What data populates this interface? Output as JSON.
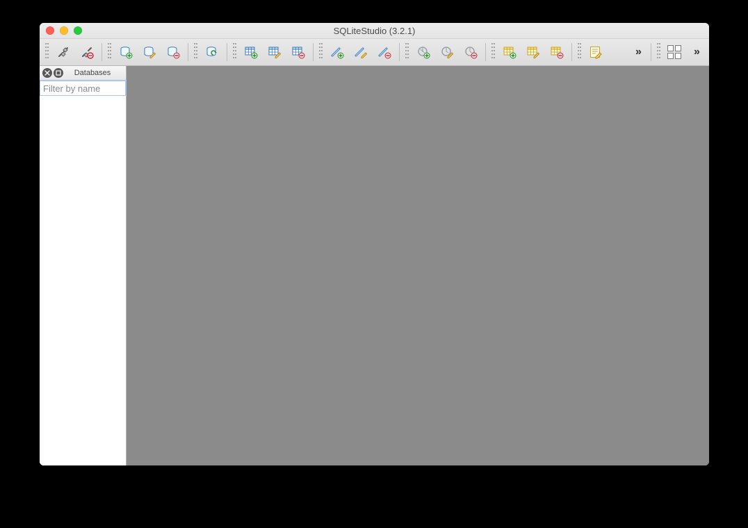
{
  "window": {
    "title": "SQLiteStudio (3.2.1)"
  },
  "sidebar": {
    "panel_title": "Databases",
    "filter_placeholder": "Filter by name"
  },
  "toolbar": {
    "groups": [
      {
        "items": [
          {
            "name": "connect-icon"
          },
          {
            "name": "disconnect-icon"
          }
        ]
      },
      {
        "items": [
          {
            "name": "add-database-icon"
          },
          {
            "name": "edit-database-icon"
          },
          {
            "name": "remove-database-icon"
          }
        ]
      },
      {
        "items": [
          {
            "name": "refresh-database-icon"
          }
        ]
      },
      {
        "items": [
          {
            "name": "add-table-icon"
          },
          {
            "name": "edit-table-icon"
          },
          {
            "name": "remove-table-icon"
          }
        ]
      },
      {
        "items": [
          {
            "name": "add-index-icon"
          },
          {
            "name": "edit-index-icon"
          },
          {
            "name": "remove-index-icon"
          }
        ]
      },
      {
        "items": [
          {
            "name": "add-trigger-icon"
          },
          {
            "name": "edit-trigger-icon"
          },
          {
            "name": "remove-trigger-icon"
          }
        ]
      },
      {
        "items": [
          {
            "name": "add-view-icon"
          },
          {
            "name": "edit-view-icon"
          },
          {
            "name": "remove-view-icon"
          }
        ]
      },
      {
        "items": [
          {
            "name": "sql-editor-icon"
          }
        ]
      }
    ]
  }
}
